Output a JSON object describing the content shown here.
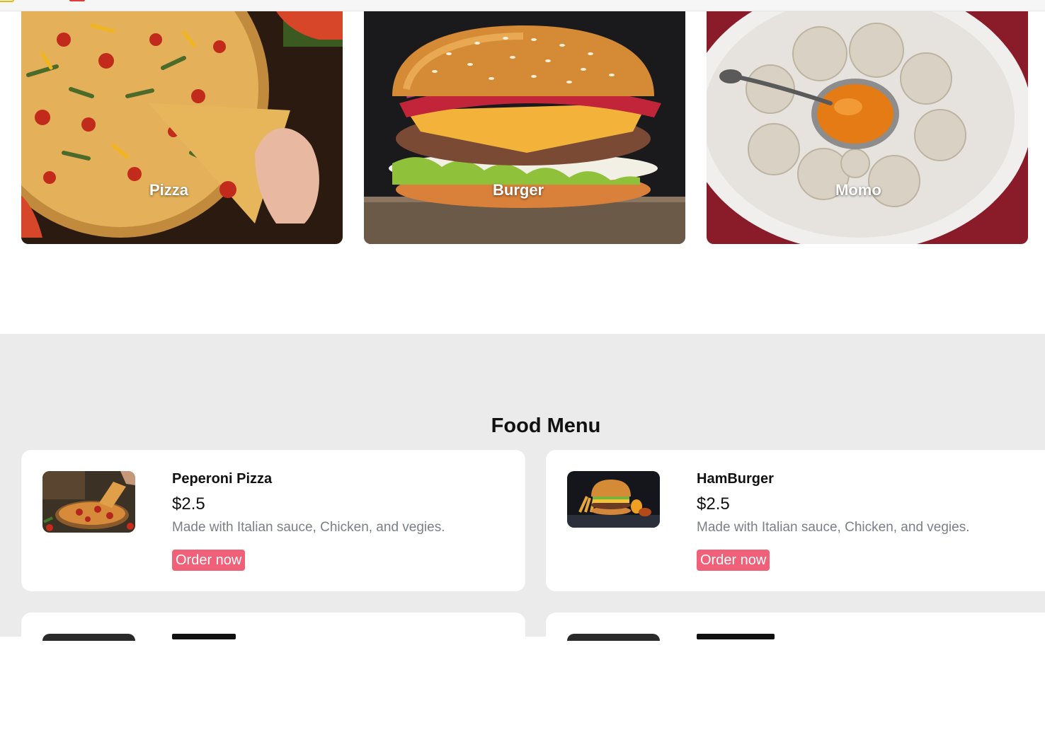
{
  "categories": [
    {
      "label": "Pizza"
    },
    {
      "label": "Burger"
    },
    {
      "label": "Momo"
    }
  ],
  "menu": {
    "title": "Food Menu",
    "items": [
      {
        "name": "Peperoni Pizza",
        "price": "$2.5",
        "description": "Made with Italian sauce, Chicken, and vegies.",
        "button": "Order now"
      },
      {
        "name": "HamBurger",
        "price": "$2.5",
        "description": "Made with Italian sauce, Chicken, and vegies.",
        "button": "Order now"
      }
    ]
  },
  "colors": {
    "accent": "#f06078",
    "section_bg": "#ebebeb",
    "muted_text": "#7a7f87"
  }
}
